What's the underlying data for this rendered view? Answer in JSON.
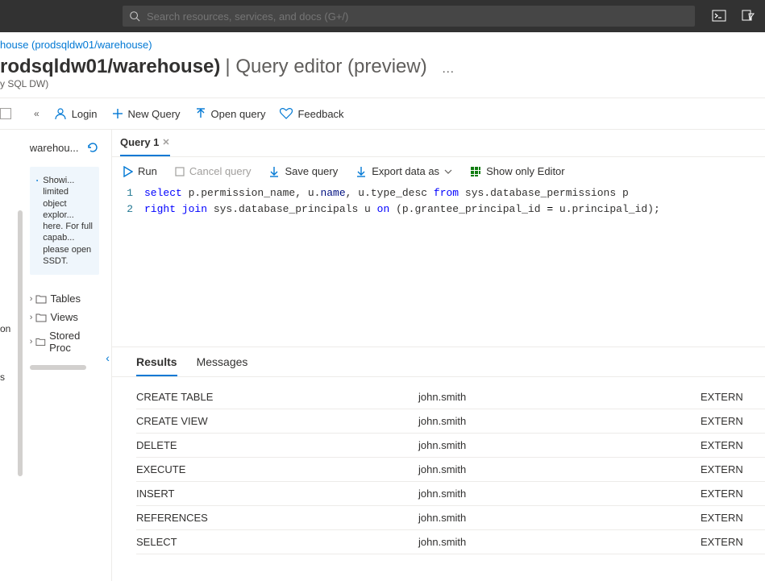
{
  "topbar": {
    "search_placeholder": "Search resources, services, and docs (G+/)"
  },
  "breadcrumb": {
    "text": "house (prodsqldw01/warehouse)"
  },
  "page": {
    "title_main": "rodsqldw01/warehouse)",
    "title_sep": " | ",
    "title_sub": "Query editor (preview)",
    "more": "…",
    "subtitle": "y SQL DW)"
  },
  "toolbar": {
    "login": "Login",
    "new_query": "New Query",
    "open_query": "Open query",
    "feedback": "Feedback"
  },
  "sidebar": {
    "db_name": "warehou...",
    "info_text": "Showi... limited object explor... here. For full capab... please open SSDT.",
    "tree": {
      "tables": "Tables",
      "views": "Views",
      "sprocs": "Stored Proc"
    }
  },
  "leftnav": {
    "item1": "on",
    "item2": "s"
  },
  "editor": {
    "tab_label": "Query 1",
    "tb": {
      "run": "Run",
      "cancel": "Cancel query",
      "save": "Save query",
      "export": "Export data as",
      "show_editor": "Show only Editor"
    },
    "code": {
      "l1_num": "1",
      "l2_num": "2",
      "l1_kw1": "select",
      "l1_t1": " p.permission_name, u.",
      "l1_fn1": "name",
      "l1_t2": ", u.type_desc ",
      "l1_kw2": "from",
      "l1_t3": " sys.database_permissions p",
      "l2_kw1": "right join",
      "l2_t1": " sys.database_principals u ",
      "l2_kw2": "on",
      "l2_t2": " (p.grantee_principal_id ",
      "l2_op": "=",
      "l2_t3": " u.principal_id);"
    }
  },
  "results": {
    "tab_results": "Results",
    "tab_messages": "Messages",
    "rows": [
      {
        "c1": "CREATE TABLE",
        "c2": "john.smith",
        "c3": "EXTERN"
      },
      {
        "c1": "CREATE VIEW",
        "c2": "john.smith",
        "c3": "EXTERN"
      },
      {
        "c1": "DELETE",
        "c2": "john.smith",
        "c3": "EXTERN"
      },
      {
        "c1": "EXECUTE",
        "c2": "john.smith",
        "c3": "EXTERN"
      },
      {
        "c1": "INSERT",
        "c2": "john.smith",
        "c3": "EXTERN"
      },
      {
        "c1": "REFERENCES",
        "c2": "john.smith",
        "c3": "EXTERN"
      },
      {
        "c1": "SELECT",
        "c2": "john.smith",
        "c3": "EXTERN"
      }
    ]
  }
}
